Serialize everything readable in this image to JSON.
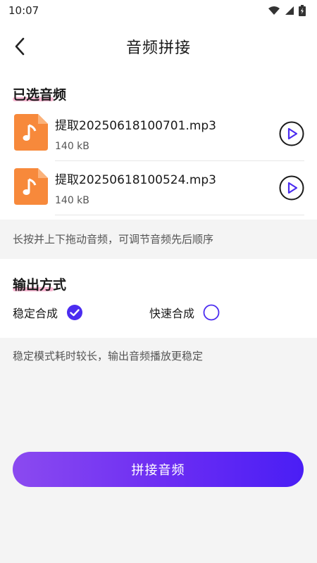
{
  "status_bar": {
    "time": "10:07"
  },
  "header": {
    "title": "音频拼接"
  },
  "selected": {
    "title": "已选音频",
    "files": [
      {
        "name": "提取20250618100701.mp3",
        "size": "140 kB"
      },
      {
        "name": "提取20250618100524.mp3",
        "size": "140 kB"
      }
    ]
  },
  "reorder_hint": "长按并上下拖动音频，可调节音频先后顺序",
  "output": {
    "title": "输出方式",
    "options": [
      {
        "label": "稳定合成",
        "selected": true
      },
      {
        "label": "快速合成",
        "selected": false
      }
    ],
    "hint": "稳定模式耗时较长，输出音频播放更稳定"
  },
  "action": {
    "merge_label": "拼接音频"
  },
  "colors": {
    "accent": "#4b2cf0",
    "file_icon": "#f7893b",
    "underline": "#f7a6c8"
  }
}
